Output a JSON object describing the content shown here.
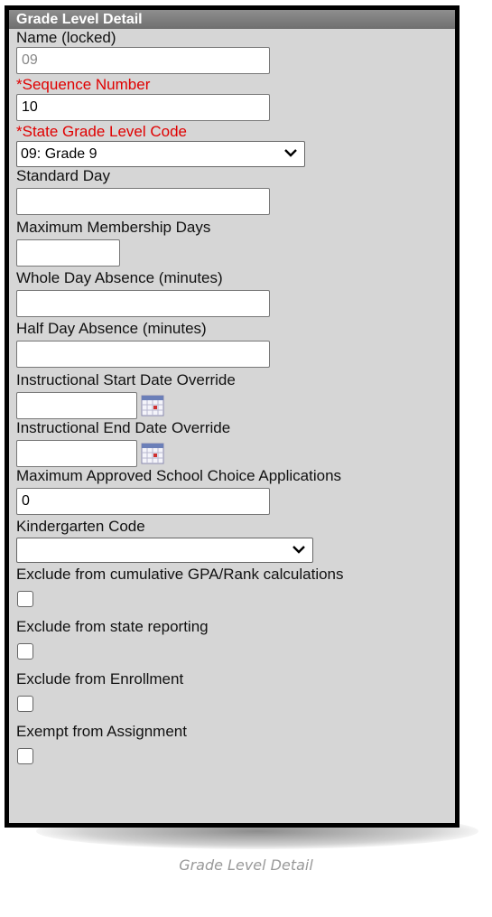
{
  "panel": {
    "title": "Grade Level Detail"
  },
  "fields": {
    "name": {
      "label": "Name (locked)",
      "value": "09"
    },
    "sequence_number": {
      "label": "*Sequence Number",
      "value": "10"
    },
    "state_grade_level_code": {
      "label": "*State Grade Level Code",
      "selected": "09: Grade 9"
    },
    "standard_day": {
      "label": "Standard Day",
      "value": ""
    },
    "maximum_membership_days": {
      "label": "Maximum Membership Days",
      "value": ""
    },
    "whole_day_absence": {
      "label": "Whole Day Absence (minutes)",
      "value": ""
    },
    "half_day_absence": {
      "label": "Half Day Absence (minutes)",
      "value": ""
    },
    "instructional_start_date_override": {
      "label": "Instructional Start Date Override",
      "value": ""
    },
    "instructional_end_date_override": {
      "label": "Instructional End Date Override",
      "value": ""
    },
    "max_school_choice_apps": {
      "label": "Maximum Approved School Choice Applications",
      "value": "0"
    },
    "kindergarten_code": {
      "label": "Kindergarten Code",
      "selected": ""
    },
    "exclude_gpa": {
      "label": "Exclude from cumulative GPA/Rank calculations",
      "checked": false
    },
    "exclude_state_reporting": {
      "label": "Exclude from state reporting",
      "checked": false
    },
    "exclude_enrollment": {
      "label": "Exclude from Enrollment",
      "checked": false
    },
    "exempt_assignment": {
      "label": "Exempt from Assignment",
      "checked": false
    }
  },
  "icons": {
    "calendar": "calendar-icon",
    "dropdown": "chevron-down-icon"
  },
  "colors": {
    "required_label": "#e00000",
    "header_bg": "#7f7f7f",
    "panel_bg": "#d6d6d6"
  },
  "caption": "Grade Level Detail"
}
